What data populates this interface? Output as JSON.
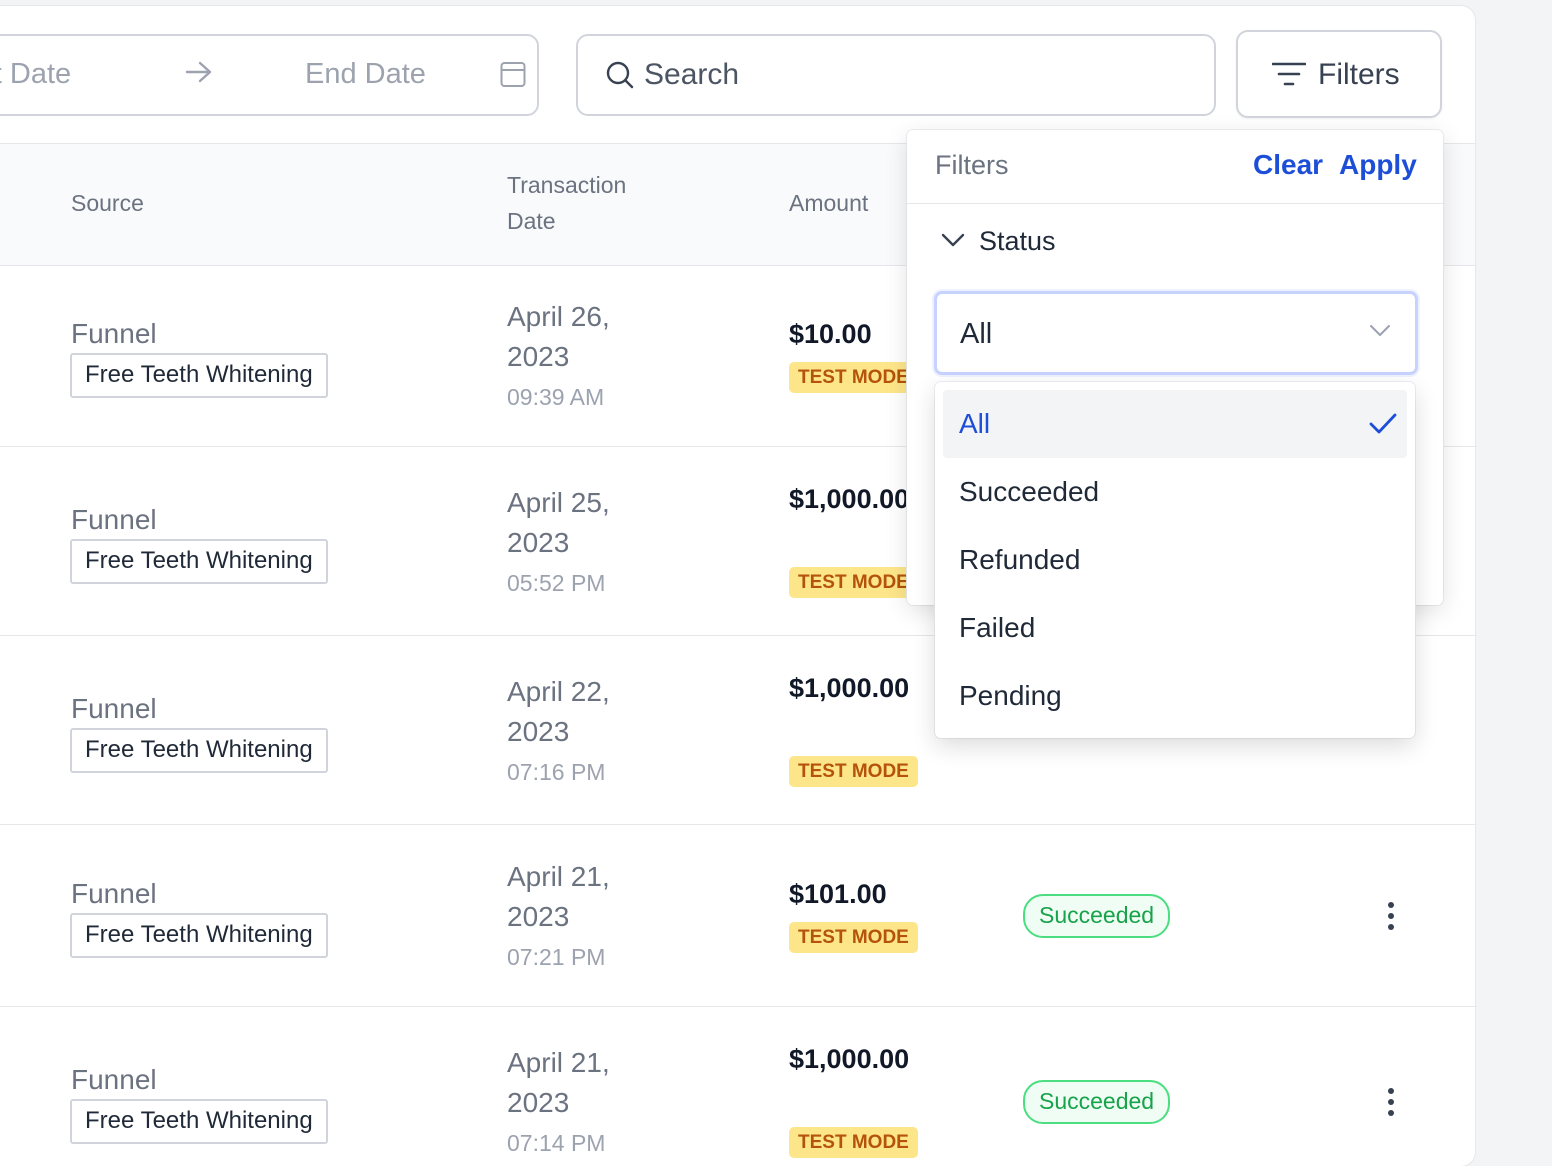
{
  "toolbar": {
    "start_date_placeholder": "art Date",
    "end_date_placeholder": "End Date",
    "search_placeholder": "Search",
    "filters_button": "Filters"
  },
  "table": {
    "columns": {
      "source": "Source",
      "transaction_date_1": "Transaction",
      "transaction_date_2": "Date",
      "amount": "Amount"
    },
    "rows": [
      {
        "source_type": "Funnel",
        "source_name": "Free Teeth Whitening",
        "date_1": "April 26,",
        "date_2": "2023",
        "time": "09:39 AM",
        "amount": "$10.00",
        "mode": "TEST MODE",
        "status": ""
      },
      {
        "source_type": "Funnel",
        "source_name": "Free Teeth Whitening",
        "date_1": "April 25,",
        "date_2": "2023",
        "time": "05:52 PM",
        "amount": "$1,000.00",
        "mode": "TEST MODE",
        "status": ""
      },
      {
        "source_type": "Funnel",
        "source_name": "Free Teeth Whitening",
        "date_1": "April 22,",
        "date_2": "2023",
        "time": "07:16 PM",
        "amount": "$1,000.00",
        "mode": "TEST MODE",
        "status": ""
      },
      {
        "source_type": "Funnel",
        "source_name": "Free Teeth Whitening",
        "date_1": "April 21,",
        "date_2": "2023",
        "time": "07:21 PM",
        "amount": "$101.00",
        "mode": "TEST MODE",
        "status": "Succeeded"
      },
      {
        "source_type": "Funnel",
        "source_name": "Free Teeth Whitening",
        "date_1": "April 21,",
        "date_2": "2023",
        "time": "07:14 PM",
        "amount": "$1,000.00",
        "mode": "TEST MODE",
        "status": "Succeeded"
      }
    ]
  },
  "filter_panel": {
    "title": "Filters",
    "clear": "Clear",
    "apply": "Apply",
    "section_label": "Status",
    "selected_value": "All",
    "options": [
      "All",
      "Succeeded",
      "Refunded",
      "Failed",
      "Pending"
    ],
    "selected_index": 0
  },
  "colors": {
    "accent": "#1d4ed8",
    "test_mode_bg": "#fde68a",
    "test_mode_text": "#b45309",
    "succeeded": "#16a34a"
  }
}
